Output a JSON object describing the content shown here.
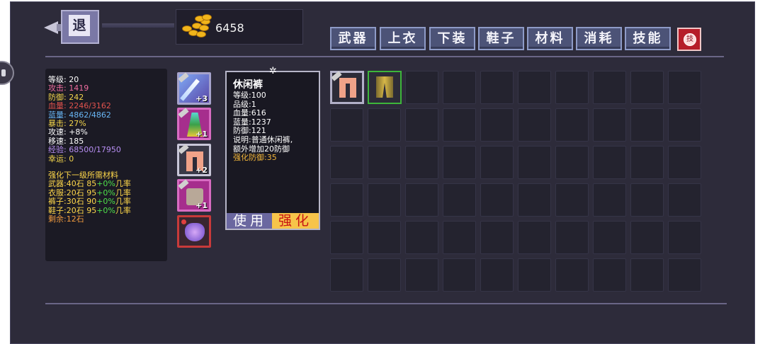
{
  "header": {
    "back_label": "退",
    "gold_amount": "6458"
  },
  "tabs": [
    {
      "label": "武器"
    },
    {
      "label": "上衣"
    },
    {
      "label": "下装"
    },
    {
      "label": "鞋子"
    },
    {
      "label": "材料"
    },
    {
      "label": "消耗"
    },
    {
      "label": "技能"
    }
  ],
  "skill_icon_label": "技",
  "stats": {
    "level": "等级: 20",
    "attack": "攻击: 1419",
    "defense": "防御: 242",
    "hp": "血量: 2246/3162",
    "mp": "蓝量: 4862/4862",
    "crit": "暴击: 27%",
    "attack_speed": "攻速: +8%",
    "move_speed": "移速: 185",
    "exp": "经验: 68500/17950",
    "luck": "幸运: 0",
    "upgrade_title": "强化下一级所需材料",
    "weapon_req": {
      "a": "武器:40石 85",
      "b": "+0%",
      "c": "几率"
    },
    "armor_req": {
      "a": "衣服:20石 95",
      "b": "+0%",
      "c": "几率"
    },
    "pants_req": {
      "a": "裤子:30石 90",
      "b": "+0%",
      "c": "几率"
    },
    "shoes_req": {
      "a": "鞋子:20石 95",
      "b": "+0%",
      "c": "几率"
    },
    "remaining": "剩余:12石"
  },
  "equipped": [
    {
      "name": "weapon",
      "level": "+3"
    },
    {
      "name": "armor",
      "level": "+1"
    },
    {
      "name": "pants",
      "level": "+2"
    },
    {
      "name": "shoes",
      "level": "+1"
    },
    {
      "name": "pet",
      "level": ""
    }
  ],
  "item_detail": {
    "name": "休闲裤",
    "level": "等级:100",
    "grade": "品级:1",
    "hp": "血量:616",
    "mp": "蓝量:1237",
    "defense": "防御:121",
    "desc1": "说明:普通休闲裤,",
    "desc2": "额外增加20防御",
    "upgrade": "强化防御:35",
    "use_label": "使用",
    "upgrade_label": "强化"
  },
  "colors": {
    "attack": "#f06ea0",
    "hp": "#e0524d",
    "mp": "#69b6f5",
    "crit": "#f3d54b",
    "exp": "#b78ef2",
    "luck": "#f3d54b",
    "upgrade_title": "#ffd84a",
    "green": "#4fe04a",
    "remaining": "#f09a3e",
    "detail_upgrade": "#f1b53a"
  }
}
